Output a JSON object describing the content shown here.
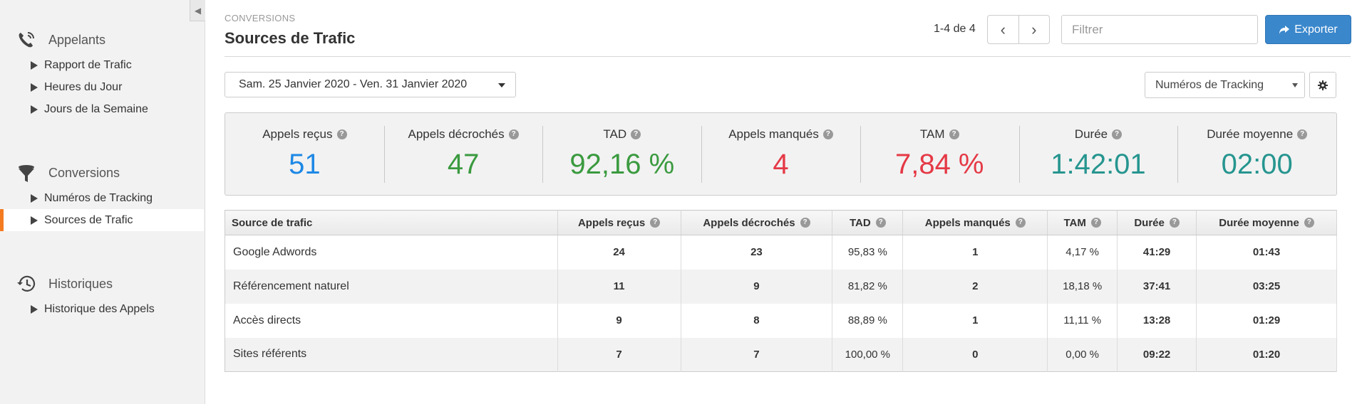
{
  "sidebar": {
    "sections": [
      {
        "title": "Appelants",
        "icon": "phone-icon",
        "items": [
          {
            "label": "Rapport de Trafic",
            "active": false
          },
          {
            "label": "Heures du Jour",
            "active": false
          },
          {
            "label": "Jours de la Semaine",
            "active": false
          }
        ]
      },
      {
        "title": "Conversions",
        "icon": "funnel-icon",
        "items": [
          {
            "label": "Numéros de Tracking",
            "active": false
          },
          {
            "label": "Sources de Trafic",
            "active": true
          }
        ]
      },
      {
        "title": "Historiques",
        "icon": "history-icon",
        "items": [
          {
            "label": "Historique des Appels",
            "active": false
          }
        ]
      }
    ]
  },
  "header": {
    "breadcrumb": "CONVERSIONS",
    "title": "Sources de Trafic",
    "pager": "1-4 de 4",
    "filter_placeholder": "Filtrer",
    "export_label": "Exporter"
  },
  "controls": {
    "date_range": "Sam. 25 Janvier 2020 - Ven. 31 Janvier 2020",
    "selected_view": "Numéros de Tracking"
  },
  "kpis": [
    {
      "label": "Appels reçus",
      "value": "51",
      "color": "#1e88e5"
    },
    {
      "label": "Appels décrochés",
      "value": "47",
      "color": "#3a9a3f"
    },
    {
      "label": "TAD",
      "value": "92,16 %",
      "color": "#3a9a3f"
    },
    {
      "label": "Appels manqués",
      "value": "4",
      "color": "#e53946"
    },
    {
      "label": "TAM",
      "value": "7,84 %",
      "color": "#e53946"
    },
    {
      "label": "Durée",
      "value": "1:42:01",
      "color": "#26958f"
    },
    {
      "label": "Durée moyenne",
      "value": "02:00",
      "color": "#26958f"
    }
  ],
  "table": {
    "columns": [
      "Source de trafic",
      "Appels reçus",
      "Appels décrochés",
      "TAD",
      "Appels manqués",
      "TAM",
      "Durée",
      "Durée moyenne"
    ],
    "rows": [
      [
        "Google Adwords",
        "24",
        "23",
        "95,83 %",
        "1",
        "4,17 %",
        "41:29",
        "01:43"
      ],
      [
        "Référencement naturel",
        "11",
        "9",
        "81,82 %",
        "2",
        "18,18 %",
        "37:41",
        "03:25"
      ],
      [
        "Accès directs",
        "9",
        "8",
        "88,89 %",
        "1",
        "11,11 %",
        "13:28",
        "01:29"
      ],
      [
        "Sites référents",
        "7",
        "7",
        "100,00 %",
        "0",
        "0,00 %",
        "09:22",
        "01:20"
      ]
    ]
  }
}
